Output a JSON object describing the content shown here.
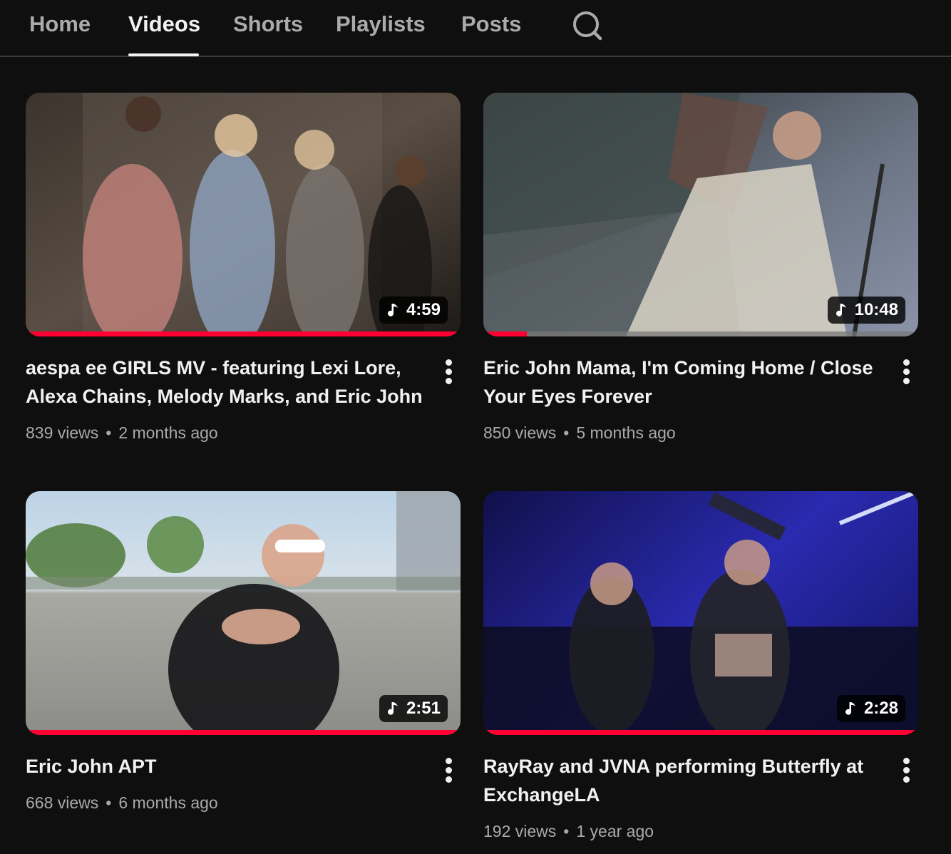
{
  "tabs": [
    {
      "label": "Home",
      "active": false
    },
    {
      "label": "Videos",
      "active": true
    },
    {
      "label": "Shorts",
      "active": false
    },
    {
      "label": "Playlists",
      "active": false
    },
    {
      "label": "Posts",
      "active": false
    }
  ],
  "search_icon": "search-icon",
  "videos": [
    {
      "title": "aespa ee GIRLS MV - featuring Lexi Lore, Alexa Chains, Melody Marks, and Eric John",
      "duration": "4:59",
      "views": "839 views",
      "age": "2 months ago",
      "watched_fraction": 1.0,
      "thumbnail_desc_icon": "music-note-icon"
    },
    {
      "title": "Eric John Mama, I'm Coming Home / Close Your Eyes Forever",
      "duration": "10:48",
      "views": "850 views",
      "age": "5 months ago",
      "watched_fraction": 0.1,
      "thumbnail_desc_icon": "music-note-icon"
    },
    {
      "title": "Eric John APT",
      "duration": "2:51",
      "views": "668 views",
      "age": "6 months ago",
      "watched_fraction": 1.0,
      "thumbnail_desc_icon": "music-note-icon"
    },
    {
      "title": "RayRay and JVNA performing Butterfly at ExchangeLA",
      "duration": "2:28",
      "views": "192 views",
      "age": "1 year ago",
      "watched_fraction": 1.0,
      "thumbnail_desc_icon": "music-note-icon"
    }
  ],
  "colors": {
    "background": "#0f0f0f",
    "progress": "#ff0033",
    "text_primary": "#f1f1f1",
    "text_secondary": "#aaaaaa"
  }
}
